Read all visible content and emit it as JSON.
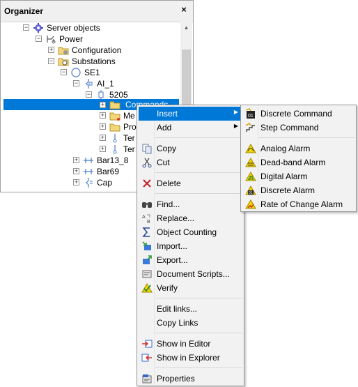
{
  "organizer": {
    "title": "Organizer",
    "close": "×",
    "tree": [
      {
        "label": "Server objects",
        "icon": "server-objects-icon"
      },
      {
        "label": "Power",
        "icon": "power-icon"
      },
      {
        "label": "Configuration",
        "icon": "folder-icon"
      },
      {
        "label": "Substations",
        "icon": "substations-icon"
      },
      {
        "label": "SE1",
        "icon": "station-icon"
      },
      {
        "label": "AI_1",
        "icon": "breaker-icon"
      },
      {
        "label": "5205",
        "icon": "node-icon"
      },
      {
        "label": "Commands",
        "icon": "folder-icon"
      },
      {
        "label": "Me",
        "icon": "folder-icon"
      },
      {
        "label": "Pro",
        "icon": "folder-icon"
      },
      {
        "label": "Ter",
        "icon": "terminal-icon"
      },
      {
        "label": "Ter",
        "icon": "terminal-icon"
      },
      {
        "label": "Bar13_8",
        "icon": "bar-icon"
      },
      {
        "label": "Bar69",
        "icon": "bar-icon"
      },
      {
        "label": "Cap",
        "icon": "capacitor-icon"
      }
    ]
  },
  "context_menu": {
    "items": [
      {
        "label": "Insert",
        "icon": "",
        "submenu": true
      },
      {
        "label": "Add",
        "icon": "",
        "submenu": true
      },
      {
        "label": "Copy",
        "icon": "copy-icon"
      },
      {
        "label": "Cut",
        "icon": "cut-icon"
      },
      {
        "label": "Delete",
        "icon": "delete-icon"
      },
      {
        "label": "Find...",
        "icon": "find-icon"
      },
      {
        "label": "Replace...",
        "icon": "replace-icon"
      },
      {
        "label": "Object Counting",
        "icon": "sigma-icon"
      },
      {
        "label": "Import...",
        "icon": "import-icon"
      },
      {
        "label": "Export...",
        "icon": "export-icon"
      },
      {
        "label": "Document Scripts...",
        "icon": "scripts-icon"
      },
      {
        "label": "Verify",
        "icon": "verify-icon"
      },
      {
        "label": "Edit links...",
        "icon": ""
      },
      {
        "label": "Copy Links",
        "icon": ""
      },
      {
        "label": "Show in Editor",
        "icon": "show-editor-icon"
      },
      {
        "label": "Show in Explorer",
        "icon": "show-explorer-icon"
      },
      {
        "label": "Properties",
        "icon": "properties-icon"
      }
    ]
  },
  "insert_submenu": {
    "items": [
      {
        "label": "Discrete Command",
        "icon": "discrete-command-icon"
      },
      {
        "label": "Step Command",
        "icon": "step-command-icon"
      },
      {
        "label": "Analog Alarm",
        "icon": "analog-alarm-icon"
      },
      {
        "label": "Dead-band Alarm",
        "icon": "deadband-alarm-icon"
      },
      {
        "label": "Digital Alarm",
        "icon": "digital-alarm-icon"
      },
      {
        "label": "Discrete Alarm",
        "icon": "discrete-alarm-icon"
      },
      {
        "label": "Rate of Change Alarm",
        "icon": "rate-alarm-icon"
      }
    ]
  },
  "colors": {
    "selection": "#0078d7",
    "menu_bg": "#f2f2f2"
  }
}
